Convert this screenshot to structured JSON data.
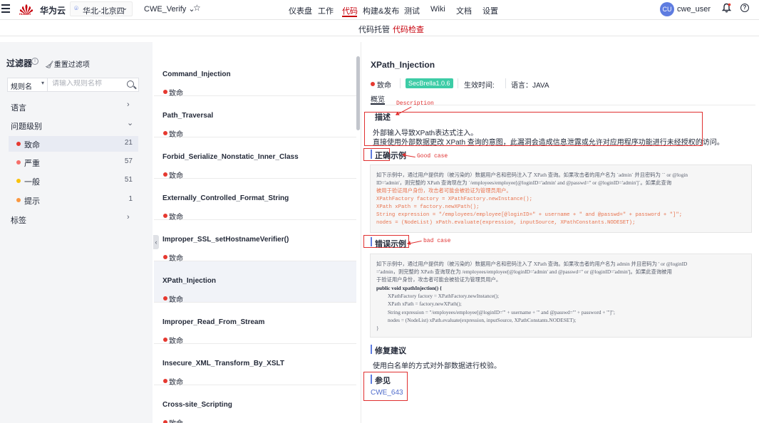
{
  "topbar": {
    "brand": "华为云",
    "logo_text": "HUAWEI",
    "region": "华北-北京四",
    "project": "CWE_Verify",
    "nav": [
      "仪表盘",
      "工作",
      "代码",
      "构建&发布",
      "测试",
      "Wiki",
      "文档",
      "设置"
    ],
    "active_nav": "代码",
    "avatar_initials": "CU",
    "username": "cwe_user"
  },
  "subnav": {
    "items": [
      "代码托管",
      "代码检查"
    ],
    "active": "代码检查"
  },
  "filter": {
    "title": "过滤器",
    "reset_label": "重置过滤项",
    "field_select": "规则名",
    "search_placeholder": "请输入规则名称",
    "groups": {
      "language": "语言",
      "severity": "问题级别",
      "tags": "标签"
    },
    "severities": [
      {
        "label": "致命",
        "count": "21",
        "color": "#e63930"
      },
      {
        "label": "严重",
        "count": "57",
        "color": "#f66f6a"
      },
      {
        "label": "一般",
        "count": "51",
        "color": "#fac20a"
      },
      {
        "label": "提示",
        "count": "1",
        "color": "#fa9841"
      }
    ]
  },
  "rules": [
    {
      "name": "Command_Injection",
      "severity": "致命"
    },
    {
      "name": "Path_Traversal",
      "severity": "致命"
    },
    {
      "name": "Forbid_Serialize_Nonstatic_Inner_Class",
      "severity": "致命"
    },
    {
      "name": "Externally_Controlled_Format_String",
      "severity": "致命"
    },
    {
      "name": "Improper_SSL_setHostnameVerifier()",
      "severity": "致命"
    },
    {
      "name": "XPath_Injection",
      "severity": "致命"
    },
    {
      "name": "Improper_Read_From_Stream",
      "severity": "致命"
    },
    {
      "name": "Insecure_XML_Transform_By_XSLT",
      "severity": "致命"
    },
    {
      "name": "Cross-site_Scripting",
      "severity": "致命"
    }
  ],
  "selected_rule": "XPath_Injection",
  "detail": {
    "title": "XPath_Injection",
    "severity": "致命",
    "badge": "SecBrella1.0.6",
    "effective_time": "生效时间:",
    "language": "语言：JAVA",
    "tab": "概览",
    "annotations": {
      "description": "Description",
      "good": "Good case",
      "bad": "bad case"
    },
    "sections": {
      "description": {
        "title": "描述",
        "lines": [
          "外部输入导致XPath表达式注入。",
          "直接使用外部数据更改 XPath 查询的意图，此漏洞会造成信息泄露或允许对应用程序功能进行未经授权的访问。"
        ]
      },
      "good": {
        "title": "正确示例",
        "lines": [
          "如下示例中，通过用户提供的（被污染的）数据用户名和密码注入了 XPath 查询。如果攻击者的用户名为 `admin` 并且密码为 `` or @login",
          "ID='admin'，则完整的 XPath 查询现在为 `/employees/employee[@loginID='admin' and @passwd='' or @loginID='admin']`。如果此查询",
          "被用于验证用户身份，攻击者可能会被验证为管理员用户。",
          "XPathFactory factory = XPathFactory.newInstance();",
          "XPath xPath = factory.newXPath();",
          "String expression = \"/employees/employee[@loginID=\" + username + \" and @passwd=\" + password + \"]\";",
          "nodes = (NodeList) xPath.evaluate(expression, inputSource, XPathConstants.NODESET);"
        ]
      },
      "bad": {
        "title": "错误示例",
        "lines": [
          "如下示例中，通过用户提供的（被污染的）数据用户名和密码注入了 XPath 查询。如果攻击者的用户名为 admin 并且密码为 ' or @loginID",
          "='admin，则完整的 XPath 查询现在为 /employees/employee[@loginID='admin' and @passwd='' or @loginID='admin']。如果此查询被用",
          "于验证用户身份，攻击者可能会被验证为管理员用户。",
          "public void xpathInjection() {",
          "XPathFactory factory = XPathFactory.newInstance();",
          "XPath xPath = factory.newXPath();",
          "String expression = \"/employees/employee[@loginID='\" + username + \"' and @passwd='\" + password + \"']\";",
          "nodes = (NodeList) xPath.evaluate(expression, inputSource, XPathConstants.NODESET);",
          "}"
        ]
      },
      "fix": {
        "title": "修复建议",
        "text": "使用白名单的方式对外部数据进行校验。"
      },
      "refs": {
        "title": "参见",
        "link": "CWE_643"
      }
    }
  }
}
